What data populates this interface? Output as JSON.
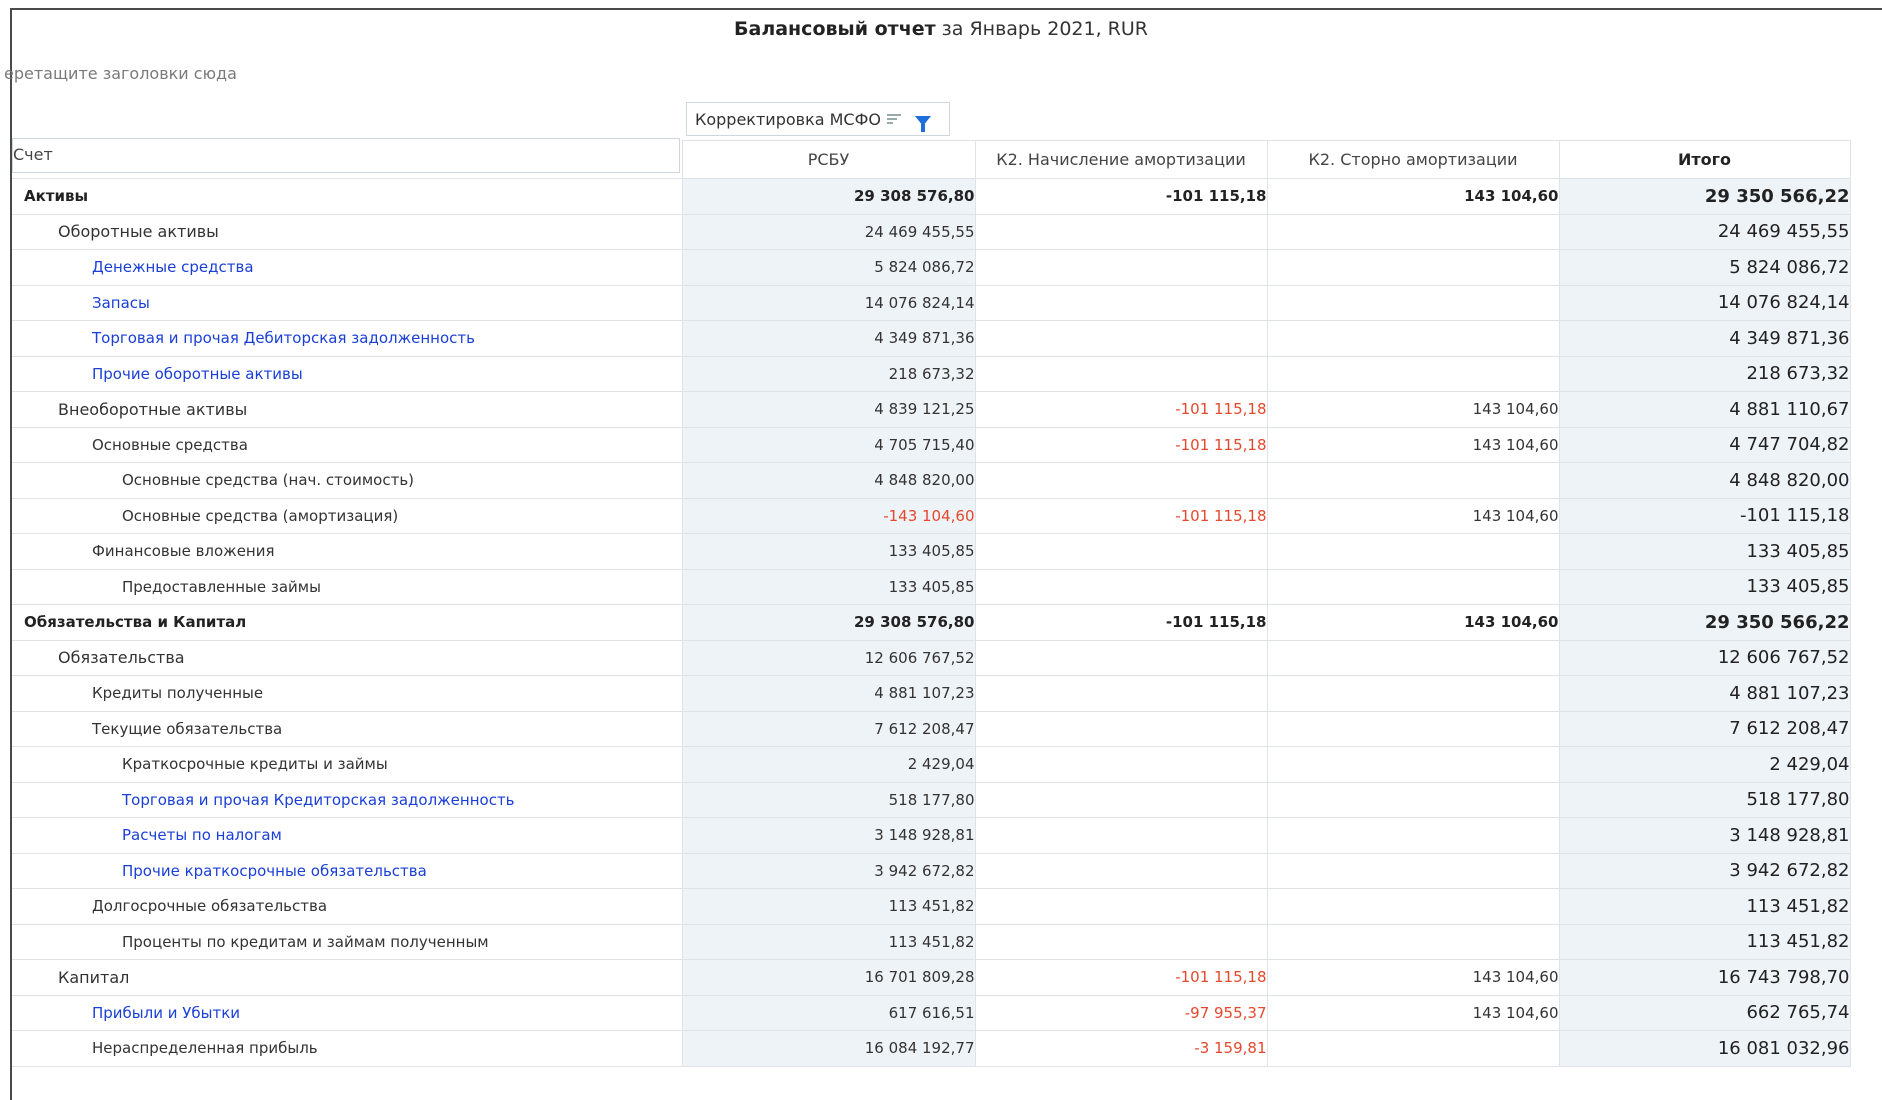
{
  "report": {
    "title_bold": "Балансовый отчет",
    "title_rest": " за Январь 2021, RUR",
    "drag_hint": "еретащите заголовки сюда"
  },
  "filter": {
    "label": "Корректировка МСФО",
    "sort_icon": "sort-lines-icon",
    "filter_icon": "filter-funnel-icon",
    "filter_color": "#1e6fd9"
  },
  "columns": {
    "account": "Счет",
    "rsbu": "РСБУ",
    "k2_accrual": "К2. Начисление амортизации",
    "k2_storno": "К2. Сторно амортизации",
    "total": "Итого"
  },
  "colors": {
    "negative": "#e5482d",
    "link": "#1a3fd6",
    "highlight_bg": "#eef3f8"
  },
  "rows": [
    {
      "name": "Активы",
      "level": 0,
      "link": false,
      "rsbu": "29 308 576,80",
      "k2a": "-101 115,18",
      "k2s": "143 104,60",
      "total": "29 350 566,22"
    },
    {
      "name": "Оборотные активы",
      "level": 1,
      "link": false,
      "rsbu": "24 469 455,55",
      "k2a": "",
      "k2s": "",
      "total": "24 469 455,55"
    },
    {
      "name": "Денежные средства",
      "level": 2,
      "link": true,
      "rsbu": "5 824 086,72",
      "k2a": "",
      "k2s": "",
      "total": "5 824 086,72"
    },
    {
      "name": "Запасы",
      "level": 2,
      "link": true,
      "rsbu": "14 076 824,14",
      "k2a": "",
      "k2s": "",
      "total": "14 076 824,14"
    },
    {
      "name": "Торговая и прочая Дебиторская задолженность",
      "level": 2,
      "link": true,
      "rsbu": "4 349 871,36",
      "k2a": "",
      "k2s": "",
      "total": "4 349 871,36"
    },
    {
      "name": "Прочие оборотные активы",
      "level": 2,
      "link": true,
      "rsbu": "218 673,32",
      "k2a": "",
      "k2s": "",
      "total": "218 673,32"
    },
    {
      "name": "Внеоборотные активы",
      "level": 1,
      "link": false,
      "rsbu": "4 839 121,25",
      "k2a": "-101 115,18",
      "k2s": "143 104,60",
      "total": "4 881 110,67"
    },
    {
      "name": "Основные средства",
      "level": 2,
      "link": false,
      "rsbu": "4 705 715,40",
      "k2a": "-101 115,18",
      "k2s": "143 104,60",
      "total": "4 747 704,82"
    },
    {
      "name": "Основные средства (нач. стоимость)",
      "level": 3,
      "link": false,
      "rsbu": "4 848 820,00",
      "k2a": "",
      "k2s": "",
      "total": "4 848 820,00"
    },
    {
      "name": "Основные средства (амортизация)",
      "level": 3,
      "link": false,
      "rsbu": "-143 104,60",
      "k2a": "-101 115,18",
      "k2s": "143 104,60",
      "total": "-101 115,18"
    },
    {
      "name": "Финансовые вложения",
      "level": 2,
      "link": false,
      "rsbu": "133 405,85",
      "k2a": "",
      "k2s": "",
      "total": "133 405,85"
    },
    {
      "name": "Предоставленные займы",
      "level": 3,
      "link": false,
      "rsbu": "133 405,85",
      "k2a": "",
      "k2s": "",
      "total": "133 405,85"
    },
    {
      "name": "Обязательства и Капитал",
      "level": 0,
      "link": false,
      "rsbu": "29 308 576,80",
      "k2a": "-101 115,18",
      "k2s": "143 104,60",
      "total": "29 350 566,22"
    },
    {
      "name": "Обязательства",
      "level": 1,
      "link": false,
      "rsbu": "12 606 767,52",
      "k2a": "",
      "k2s": "",
      "total": "12 606 767,52"
    },
    {
      "name": "Кредиты полученные",
      "level": 2,
      "link": false,
      "rsbu": "4 881 107,23",
      "k2a": "",
      "k2s": "",
      "total": "4 881 107,23"
    },
    {
      "name": "Текущие обязательства",
      "level": 2,
      "link": false,
      "rsbu": "7 612 208,47",
      "k2a": "",
      "k2s": "",
      "total": "7 612 208,47"
    },
    {
      "name": "Краткосрочные кредиты и займы",
      "level": 3,
      "link": false,
      "rsbu": "2 429,04",
      "k2a": "",
      "k2s": "",
      "total": "2 429,04"
    },
    {
      "name": "Торговая и прочая Кредиторская задолженность",
      "level": 3,
      "link": true,
      "rsbu": "518 177,80",
      "k2a": "",
      "k2s": "",
      "total": "518 177,80"
    },
    {
      "name": "Расчеты по налогам",
      "level": 3,
      "link": true,
      "rsbu": "3 148 928,81",
      "k2a": "",
      "k2s": "",
      "total": "3 148 928,81"
    },
    {
      "name": "Прочие краткосрочные обязательства",
      "level": 3,
      "link": true,
      "rsbu": "3 942 672,82",
      "k2a": "",
      "k2s": "",
      "total": "3 942 672,82"
    },
    {
      "name": "Долгосрочные обязательства",
      "level": 2,
      "link": false,
      "rsbu": "113 451,82",
      "k2a": "",
      "k2s": "",
      "total": "113 451,82"
    },
    {
      "name": "Проценты по кредитам и займам полученным",
      "level": 3,
      "link": false,
      "rsbu": "113 451,82",
      "k2a": "",
      "k2s": "",
      "total": "113 451,82"
    },
    {
      "name": "Капитал",
      "level": 1,
      "link": false,
      "rsbu": "16 701 809,28",
      "k2a": "-101 115,18",
      "k2s": "143 104,60",
      "total": "16 743 798,70"
    },
    {
      "name": "Прибыли и Убытки",
      "level": 2,
      "link": true,
      "rsbu": "617 616,51",
      "k2a": "-97 955,37",
      "k2s": "143 104,60",
      "total": "662 765,74"
    },
    {
      "name": "Нераспределенная прибыль",
      "level": 2,
      "link": false,
      "rsbu": "16 084 192,77",
      "k2a": "-3 159,81",
      "k2s": "",
      "total": "16 081 032,96"
    }
  ]
}
